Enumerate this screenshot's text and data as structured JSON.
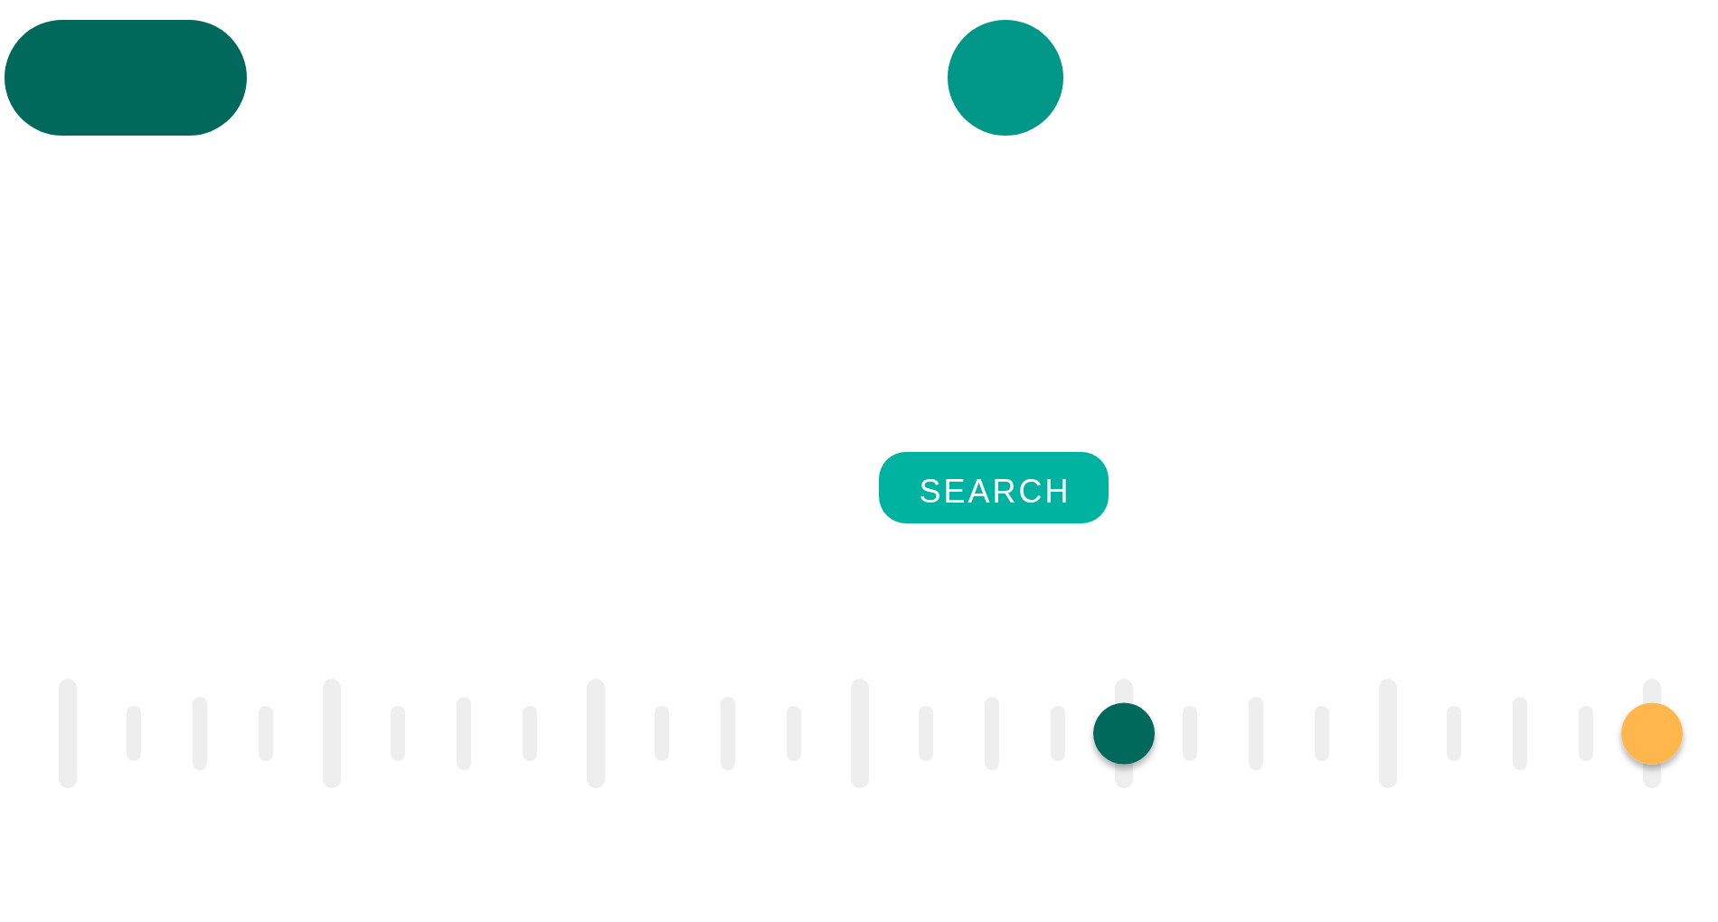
{
  "shapes": [
    {
      "kind": "pill",
      "color": "#00695c"
    },
    {
      "kind": "circle",
      "color": "#009688"
    }
  ],
  "search_button": {
    "label": "SEARCH"
  },
  "slider": {
    "thumbs": [
      {
        "level": 0.6667,
        "color": "#00695c"
      },
      {
        "level": 1,
        "color": "#ffb74d"
      }
    ]
  }
}
